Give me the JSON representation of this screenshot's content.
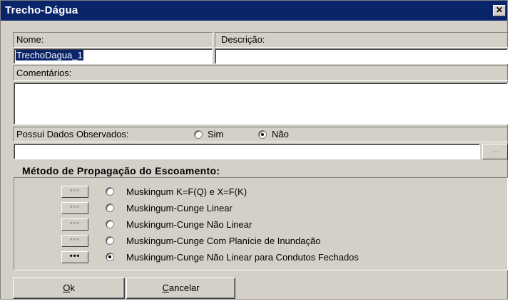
{
  "window": {
    "title": "Trecho-Dágua",
    "close_glyph": "✕"
  },
  "form": {
    "name_label": "Nome:",
    "name_value": "TrechoDagua_1",
    "description_label": "Descrição:",
    "description_value": "",
    "comments_label": "Comentários:",
    "comments_value": "",
    "observed_label": "Possui Dados Observados:",
    "observed_options": [
      {
        "label": "Sim",
        "checked": false
      },
      {
        "label": "Não",
        "checked": true
      }
    ],
    "observed_path_value": "",
    "browse_label": "..."
  },
  "method": {
    "title": "Método de Propagação do Escoamento:",
    "options": [
      {
        "label": "Muskingum K=F(Q) e X=F(K)",
        "checked": false,
        "button": "•••",
        "button_enabled": false
      },
      {
        "label": "Muskingum-Cunge Linear",
        "checked": false,
        "button": "•••",
        "button_enabled": false
      },
      {
        "label": "Muskingum-Cunge Não Linear",
        "checked": false,
        "button": "•••",
        "button_enabled": false
      },
      {
        "label": "Muskingum-Cunge Com Planície de Inundação",
        "checked": false,
        "button": "•••",
        "button_enabled": false
      },
      {
        "label": "Muskingum-Cunge Não Linear para Condutos Fechados",
        "checked": true,
        "button": "•••",
        "button_enabled": true
      }
    ]
  },
  "buttons": {
    "ok_mnemonic": "O",
    "ok_rest": "k",
    "cancel_mnemonic": "C",
    "cancel_rest": "ancelar"
  }
}
